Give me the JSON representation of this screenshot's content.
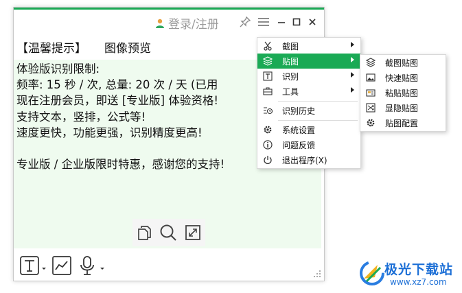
{
  "titlebar": {
    "login_label": "登录/注册"
  },
  "tabs": [
    {
      "label": "【温馨提示】"
    },
    {
      "label": "图像预览"
    }
  ],
  "content": {
    "lines": [
      "体验版识别限制:",
      "频率: 15 秒 / 次, 总量: 20 次 / 天 (已用",
      "现在注册会员，即送 [专业版] 体验资格!",
      "支持文本，竖排，公式等!",
      "速度更快，功能更强，识别精度更高!",
      "",
      "专业版 / 企业版限时特惠，感谢您的支持!"
    ]
  },
  "menu_main": {
    "items": [
      {
        "label": "截图",
        "icon": "scissors-icon",
        "submenu": true
      },
      {
        "label": "贴图",
        "icon": "layers-icon",
        "submenu": true,
        "active": true
      },
      {
        "label": "识别",
        "icon": "text-recognize-icon",
        "submenu": true
      },
      {
        "label": "工具",
        "icon": "toolbox-icon",
        "submenu": true
      },
      {
        "label": "识别历史",
        "icon": "history-icon"
      },
      {
        "label": "系统设置",
        "icon": "gear-icon"
      },
      {
        "label": "问题反馈",
        "icon": "info-icon"
      },
      {
        "label": "退出程序(X)",
        "icon": "power-icon"
      }
    ]
  },
  "menu_sub": {
    "items": [
      {
        "label": "截图贴图",
        "icon": "layers-icon"
      },
      {
        "label": "快速贴图",
        "icon": "image-icon"
      },
      {
        "label": "粘贴贴图",
        "icon": "paste-icon"
      },
      {
        "label": "显隐贴图",
        "icon": "shuffle-icon"
      },
      {
        "label": "贴图配置",
        "icon": "gear-icon"
      }
    ]
  },
  "watermark": {
    "name": "极光下载站",
    "url": "www.xz7.com"
  },
  "colors": {
    "accent": "#1aaa55",
    "content_bg": "#effbef",
    "login_text": "#9a9a9a"
  }
}
